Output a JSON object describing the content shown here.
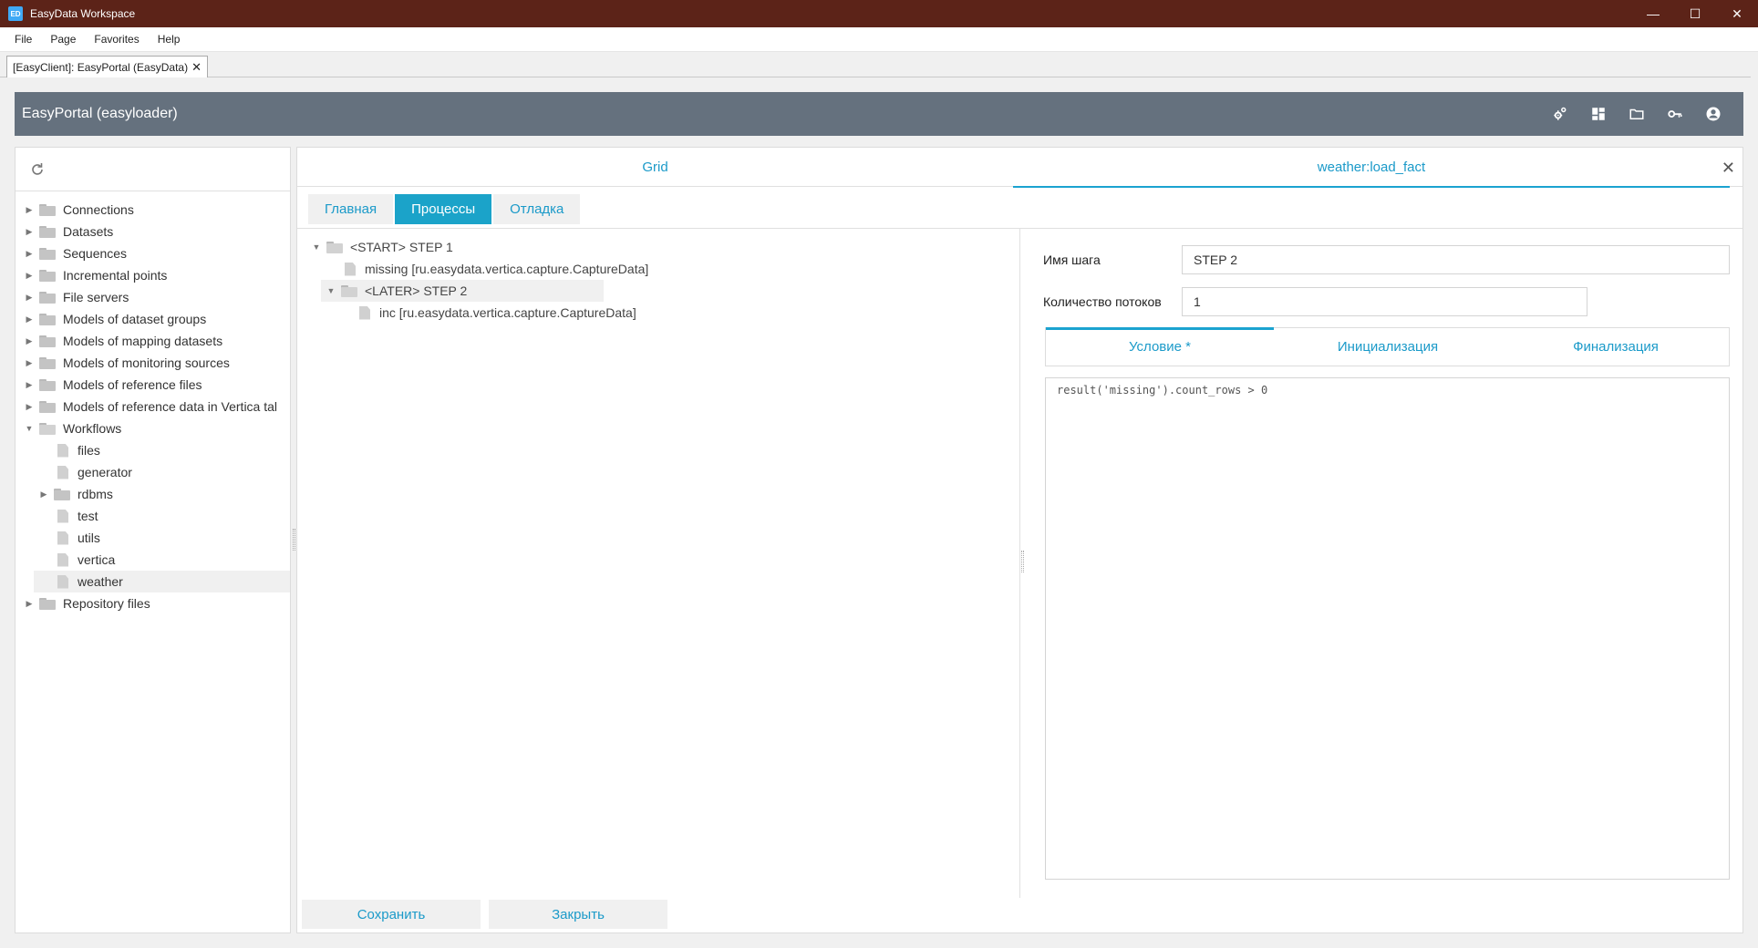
{
  "window": {
    "title": "EasyData Workspace",
    "icon_text": "ED"
  },
  "menu": [
    "File",
    "Page",
    "Favorites",
    "Help"
  ],
  "doc_tab": {
    "label": "[EasyClient]: EasyPortal (EasyData)",
    "close": "✕"
  },
  "header": {
    "title": "EasyPortal (easyloader)",
    "icons": [
      "settings-icon",
      "dashboard-icon",
      "folder-icon",
      "key-icon",
      "account-icon"
    ]
  },
  "tree": {
    "items": [
      {
        "label": "Connections",
        "type": "folder",
        "level": 0,
        "expanded": false
      },
      {
        "label": "Datasets",
        "type": "folder",
        "level": 0,
        "expanded": false
      },
      {
        "label": "Sequences",
        "type": "folder",
        "level": 0,
        "expanded": false
      },
      {
        "label": "Incremental points",
        "type": "folder",
        "level": 0,
        "expanded": false
      },
      {
        "label": "File servers",
        "type": "folder",
        "level": 0,
        "expanded": false
      },
      {
        "label": "Models of dataset groups",
        "type": "folder",
        "level": 0,
        "expanded": false
      },
      {
        "label": "Models of mapping datasets",
        "type": "folder",
        "level": 0,
        "expanded": false
      },
      {
        "label": "Models of monitoring sources",
        "type": "folder",
        "level": 0,
        "expanded": false
      },
      {
        "label": "Models of reference files",
        "type": "folder",
        "level": 0,
        "expanded": false
      },
      {
        "label": "Models of reference data in Vertica tal",
        "type": "folder",
        "level": 0,
        "expanded": false
      },
      {
        "label": "Workflows",
        "type": "folder",
        "level": 0,
        "expanded": true
      },
      {
        "label": "files",
        "type": "file",
        "level": 1
      },
      {
        "label": "generator",
        "type": "file",
        "level": 1
      },
      {
        "label": "rdbms",
        "type": "folder",
        "level": 1,
        "expanded": false
      },
      {
        "label": "test",
        "type": "file",
        "level": 1
      },
      {
        "label": "utils",
        "type": "file",
        "level": 1
      },
      {
        "label": "vertica",
        "type": "file",
        "level": 1
      },
      {
        "label": "weather",
        "type": "file",
        "level": 1,
        "selected": true
      },
      {
        "label": "Repository files",
        "type": "folder",
        "level": 0,
        "expanded": false
      }
    ]
  },
  "top_tabs": {
    "grid": "Grid",
    "active": "weather:load_fact",
    "close": "✕"
  },
  "sub_tabs": {
    "main": "Главная",
    "processes": "Процессы",
    "debug": "Отладка"
  },
  "steps": [
    {
      "label": "<START> STEP 1",
      "type": "folder",
      "level": 0
    },
    {
      "label": "missing [ru.easydata.vertica.capture.CaptureData]",
      "type": "file",
      "level": 1
    },
    {
      "label": "<LATER> STEP 2",
      "type": "folder",
      "level": 1,
      "selected": true
    },
    {
      "label": "inc [ru.easydata.vertica.capture.CaptureData]",
      "type": "file",
      "level": 2
    }
  ],
  "form": {
    "step_name_label": "Имя шага",
    "step_name_value": "STEP 2",
    "threads_label": "Количество потоков",
    "threads_value": "1"
  },
  "cond_tabs": {
    "condition": "Условие *",
    "init": "Инициализация",
    "final": "Финализация"
  },
  "editor": {
    "code": "result('missing').count_rows > 0"
  },
  "buttons": {
    "save": "Сохранить",
    "close": "Закрыть"
  },
  "colors": {
    "accent": "#1ba3c9",
    "header": "#65717e",
    "titlebar": "#5c2318"
  }
}
